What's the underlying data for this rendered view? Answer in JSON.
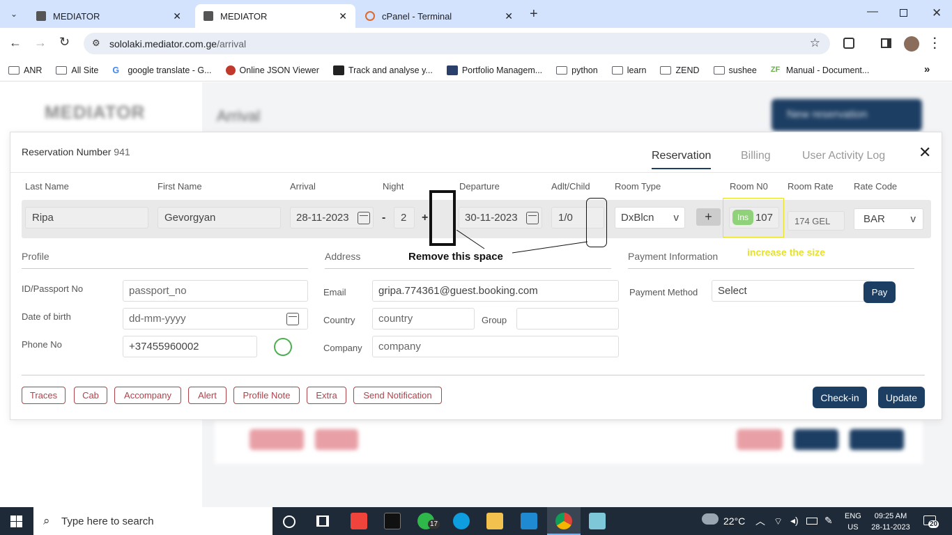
{
  "browser": {
    "tabs": [
      {
        "title": "MEDIATOR"
      },
      {
        "title": "MEDIATOR"
      },
      {
        "title": "cPanel - Terminal"
      }
    ],
    "url_host": "sololaki.mediator.com.ge",
    "url_path": "/arrival",
    "bookmarks": [
      "ANR",
      "All Site",
      "google translate - G...",
      "Online JSON Viewer",
      "Track and analyse y...",
      "Portfolio Managem...",
      "python",
      "learn",
      "ZEND",
      "sushee",
      "Manual - Document..."
    ]
  },
  "background": {
    "logo": "MEDIATOR",
    "page_title": "Arrival",
    "new_reservation": "New reservation"
  },
  "modal": {
    "reservation_label": "Reservation Number",
    "reservation_number": "941",
    "tabs": [
      "Reservation",
      "Billing",
      "User Activity Log"
    ],
    "close": "✕",
    "fields": {
      "last_name_label": "Last Name",
      "last_name": "Ripa",
      "first_name_label": "First Name",
      "first_name": "Gevorgyan",
      "arrival_label": "Arrival",
      "arrival": "28-11-2023",
      "dash": "-",
      "night_label": "Night",
      "night": "2",
      "plus": "+",
      "departure_label": "Departure",
      "departure": "30-11-2023",
      "adlt_label": "Adlt/Child",
      "adlt": "1/0",
      "room_type_label": "Room Type",
      "room_type": "DxBlcn",
      "room_type_caret": "v",
      "add_btn": "+",
      "room_no_label": "Room N0",
      "room_ins": "Ins",
      "room_no": "107",
      "room_rate_label": "Room Rate",
      "room_rate": "174 GEL",
      "rate_code_label": "Rate Code",
      "rate_code": "BAR",
      "rate_code_caret": "v"
    },
    "annotations": {
      "remove_space": "Remove this space",
      "increase_size": "increase the size"
    },
    "profile": {
      "title": "Profile",
      "passport_label": "ID/Passport No",
      "passport_placeholder": "passport_no",
      "dob_label": "Date of birth",
      "dob_placeholder": "dd-mm-yyyy",
      "phone_label": "Phone No",
      "phone": "+37455960002"
    },
    "address": {
      "title": "Address",
      "email_label": "Email",
      "email": "gripa.774361@guest.booking.com",
      "country_label": "Country",
      "country_placeholder": "country",
      "group_label": "Group",
      "company_label": "Company",
      "company_placeholder": "company"
    },
    "payment": {
      "title": "Payment Information",
      "method_label": "Payment Method",
      "method_value": "Select",
      "pay": "Pay"
    },
    "actions": [
      "Traces",
      "Cab",
      "Accompany",
      "Alert",
      "Profile Note",
      "Extra",
      "Send Notification"
    ],
    "checkin": "Check-in",
    "update": "Update"
  },
  "taskbar": {
    "search": "Type here to search",
    "weather": "22°C",
    "lang1": "ENG",
    "lang2": "US",
    "time": "09:25 AM",
    "date": "28-11-2023",
    "notif": "20",
    "whatsapp_badge": "17"
  }
}
